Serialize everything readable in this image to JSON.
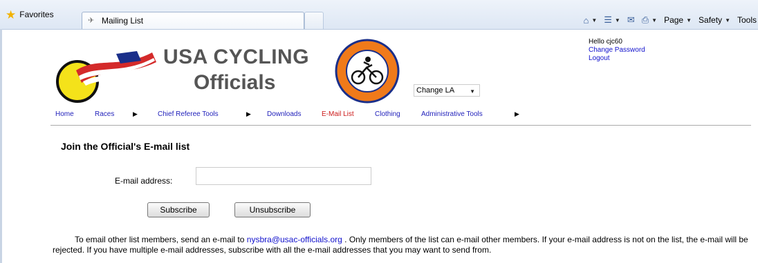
{
  "browser": {
    "favorites_label": "Favorites",
    "tab_title": "Mailing List",
    "commands": {
      "page": "Page",
      "safety": "Safety",
      "tools": "Tools"
    }
  },
  "site": {
    "brand_line1": "USA CYCLING",
    "brand_line2": "Officials",
    "la_select_value": "Change LA",
    "user": {
      "greeting": "Hello cjc60",
      "change_password": "Change Password",
      "logout": "Logout"
    },
    "nav": [
      {
        "label": "Home",
        "has_menu": false,
        "active": false
      },
      {
        "label": "Races",
        "has_menu": true,
        "active": false
      },
      {
        "label": "Chief Referee Tools",
        "has_menu": true,
        "active": false
      },
      {
        "label": "Downloads",
        "has_menu": false,
        "active": false
      },
      {
        "label": "E-Mail List",
        "has_menu": false,
        "active": true
      },
      {
        "label": "Clothing",
        "has_menu": false,
        "active": false
      },
      {
        "label": "Administrative Tools",
        "has_menu": true,
        "active": false
      }
    ]
  },
  "form": {
    "heading": "Join the Official's E-mail list",
    "email_label": "E-mail address:",
    "email_value": "",
    "subscribe_label": "Subscribe",
    "unsubscribe_label": "Unsubscribe"
  },
  "info": {
    "text_before": "To email other list members, send an e-mail to",
    "email_link": "nysbra@usac-officials.org",
    "text_after": ".  Only members of the list can e-mail other members.  If your e-mail address is not on the list, the e-mail will be rejected.  If you have multiple e-mail addresses, subscribe with all the e-mail addresses that you may want to send from."
  },
  "colors": {
    "link": "#1010cc",
    "nav_link": "#2222bb",
    "nav_active": "#cc1a1a",
    "brand_text": "#555555"
  }
}
